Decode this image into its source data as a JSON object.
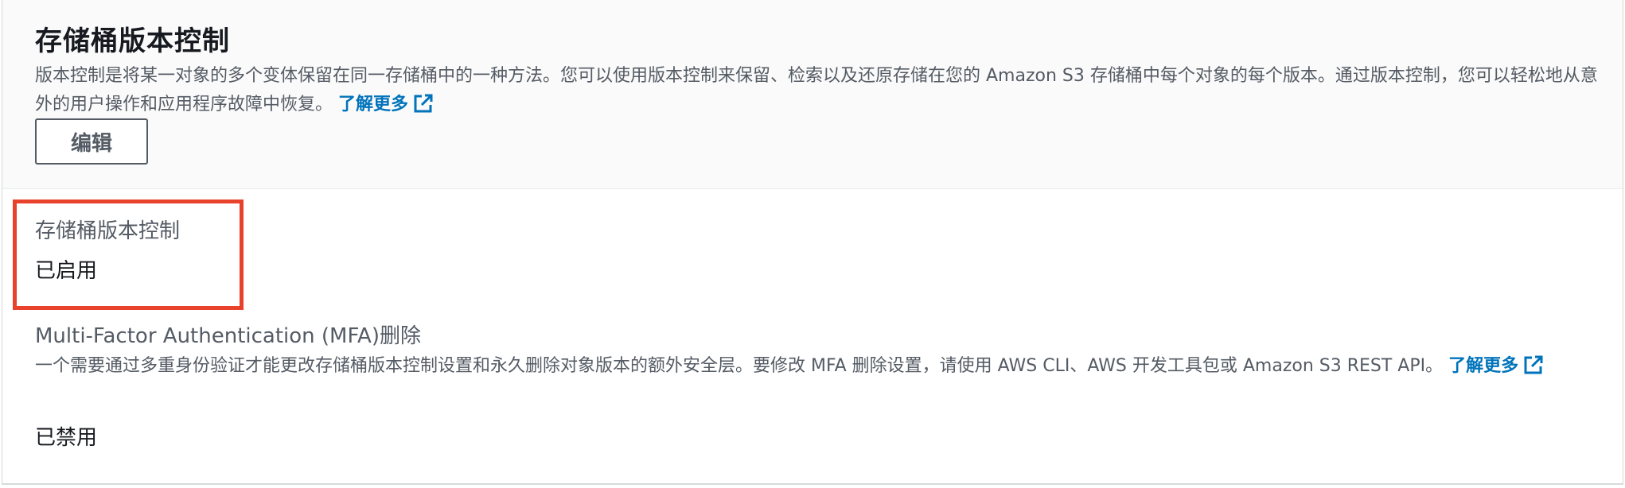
{
  "versioning": {
    "title": "存储桶版本控制",
    "description": "版本控制是将某一对象的多个变体保留在同一存储桶中的一种方法。您可以使用版本控制来保留、检索以及还原存储在您的 Amazon S3 存储桶中每个对象的每个版本。通过版本控制，您可以轻松地从意外的用户操作和应用程序故障中恢复。",
    "learn_more": "了解更多",
    "edit_label": "编辑",
    "status_label": "存储桶版本控制",
    "status_value": "已启用"
  },
  "mfa": {
    "label": "Multi-Factor Authentication (MFA)删除",
    "description": "一个需要通过多重身份验证才能更改存储桶版本控制设置和永久删除对象版本的额外安全层。要修改 MFA 删除设置，请使用 AWS CLI、AWS 开发工具包或 Amazon S3 REST API。",
    "learn_more": "了解更多",
    "value": "已禁用"
  },
  "icons": {
    "external_link": "external-link-icon"
  },
  "colors": {
    "link": "#0073bb",
    "highlight": "#e8412c",
    "header_bg": "#fafafa"
  }
}
